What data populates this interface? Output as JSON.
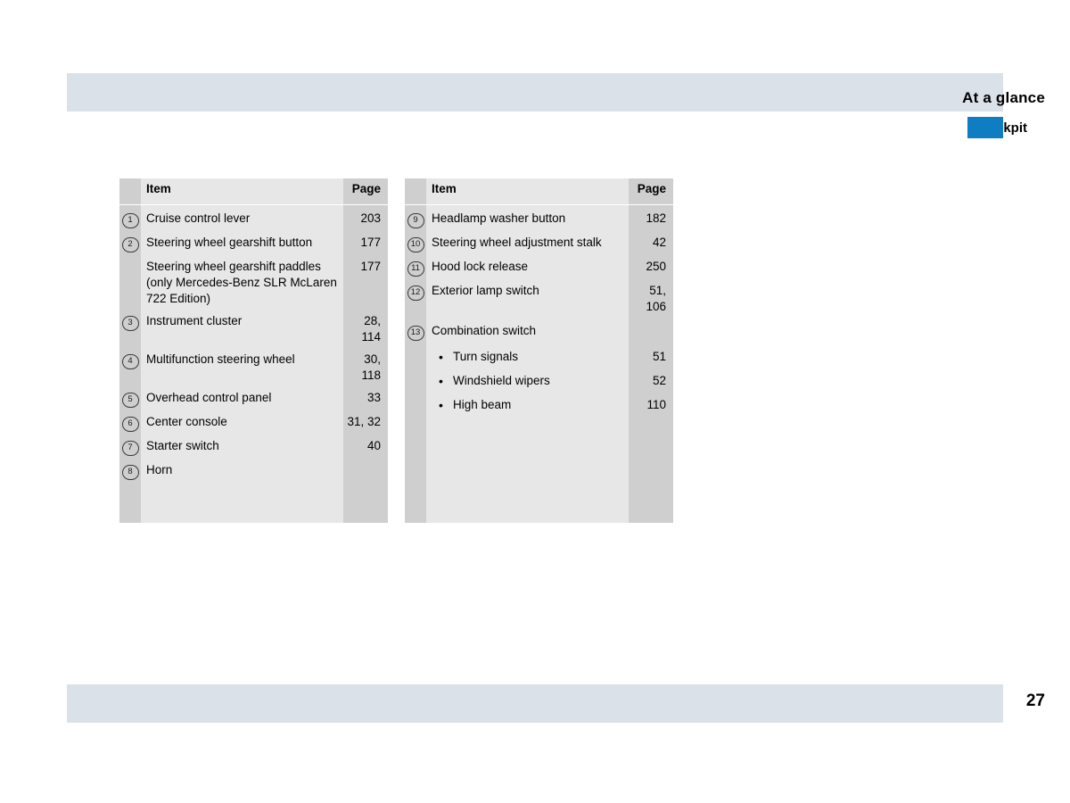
{
  "header": {
    "title": "At a glance",
    "subtitle": "Cockpit",
    "accent_color": "#0f7dc2",
    "bar_color": "#dbe1e9"
  },
  "footer": {
    "page_number": "27",
    "bar_color": "#dbe1e9"
  },
  "tables": [
    {
      "id": "left",
      "columns": {
        "item": "Item",
        "page": "Page"
      },
      "rows": [
        {
          "marker": "1",
          "item": "Cruise control lever",
          "page": "203"
        },
        {
          "marker": "2",
          "item": "Steering wheel gearshift button",
          "page": "177"
        },
        {
          "marker": "",
          "item": "Steering wheel gearshift paddles (only Mercedes-Benz SLR McLaren 722 Edition)",
          "page": "177"
        },
        {
          "marker": "3",
          "item": "Instrument cluster",
          "page": "28,\n114"
        },
        {
          "marker": "4",
          "item": "Multifunction steering wheel",
          "page": "30,\n118"
        },
        {
          "marker": "5",
          "item": "Overhead control panel",
          "page": "33"
        },
        {
          "marker": "6",
          "item": "Center console",
          "page": "31, 32"
        },
        {
          "marker": "7",
          "item": "Starter switch",
          "page": "40"
        },
        {
          "marker": "8",
          "item": "Horn",
          "page": ""
        }
      ]
    },
    {
      "id": "right",
      "columns": {
        "item": "Item",
        "page": "Page"
      },
      "rows": [
        {
          "marker": "9",
          "item": "Headlamp washer button",
          "page": "182"
        },
        {
          "marker": "10",
          "item": "Steering wheel adjustment stalk",
          "page": "42"
        },
        {
          "marker": "11",
          "item": "Hood lock release",
          "page": "250"
        },
        {
          "marker": "12",
          "item": "Exterior lamp switch",
          "page": "51,\n106"
        },
        {
          "marker": "13",
          "item": "Combination switch",
          "page": ""
        },
        {
          "marker": "",
          "bullet": true,
          "item": "Turn signals",
          "page": "51"
        },
        {
          "marker": "",
          "bullet": true,
          "item": "Windshield wipers",
          "page": "52"
        },
        {
          "marker": "",
          "bullet": true,
          "item": "High beam",
          "page": "110"
        }
      ]
    }
  ]
}
